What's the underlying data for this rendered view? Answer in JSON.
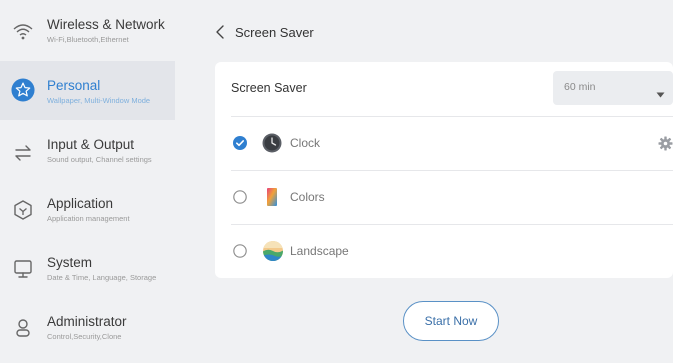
{
  "sidebar": {
    "items": [
      {
        "title": "Wireless & Network",
        "subtitle": "Wi-Fi,Bluetooth,Ethernet",
        "icon": "wifi-icon"
      },
      {
        "title": "Personal",
        "subtitle": "Wallpaper, Multi-Window Mode",
        "icon": "star-icon",
        "active": true
      },
      {
        "title": "Input & Output",
        "subtitle": "Sound output, Channel settings",
        "icon": "swap-arrows-icon"
      },
      {
        "title": "Application",
        "subtitle": "Application management",
        "icon": "hexagon-icon"
      },
      {
        "title": "System",
        "subtitle": "Date & Time, Language, Storage",
        "icon": "monitor-icon"
      },
      {
        "title": "Administrator",
        "subtitle": "Control,Security,Clone",
        "icon": "person-icon"
      }
    ]
  },
  "header": {
    "title": "Screen Saver",
    "back_icon": "chevron-left-icon"
  },
  "settings": {
    "screen_saver_label": "Screen Saver",
    "timeout_value": "60 min",
    "options": [
      {
        "label": "Clock",
        "selected": true
      },
      {
        "label": "Colors",
        "selected": false
      },
      {
        "label": "Landscape",
        "selected": false
      }
    ]
  },
  "actions": {
    "start_now": "Start Now"
  },
  "colors": {
    "accent": "#2f7fd0",
    "selected_radio": "#2f7fd0",
    "button_border": "#5a91c6"
  }
}
